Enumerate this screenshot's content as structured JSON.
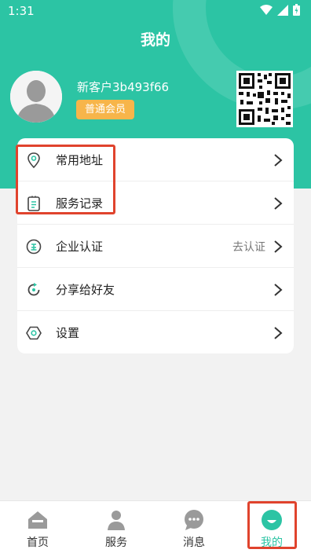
{
  "status_bar": {
    "time": "1:31"
  },
  "header": {
    "title": "我的"
  },
  "profile": {
    "username": "新客户3b493f66",
    "member_level": "普通会员"
  },
  "menu": {
    "items": [
      {
        "label": "常用地址",
        "value": "",
        "icon": "location-pin-icon"
      },
      {
        "label": "服务记录",
        "value": "",
        "icon": "clipboard-list-icon"
      },
      {
        "label": "企业认证",
        "value": "去认证",
        "icon": "enterprise-badge-icon"
      },
      {
        "label": "分享给好友",
        "value": "",
        "icon": "share-refresh-icon"
      },
      {
        "label": "设置",
        "value": "",
        "icon": "settings-hexagon-icon"
      }
    ]
  },
  "tabbar": {
    "tabs": [
      {
        "label": "首页",
        "icon": "home-icon",
        "active": false
      },
      {
        "label": "服务",
        "icon": "person-icon",
        "active": false
      },
      {
        "label": "消息",
        "icon": "message-icon",
        "active": false
      },
      {
        "label": "我的",
        "icon": "profile-icon",
        "active": true
      }
    ]
  },
  "colors": {
    "primary": "#2cc4a4",
    "badge": "#f7b54a",
    "highlight": "#e0432d"
  }
}
